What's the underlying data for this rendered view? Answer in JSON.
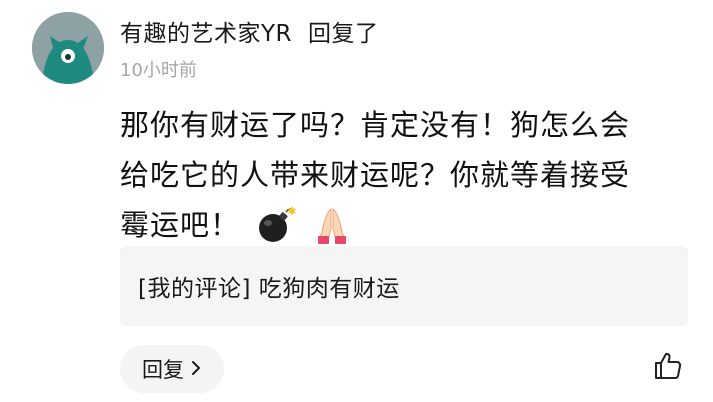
{
  "comment": {
    "username": "有趣的艺术家YR",
    "action": "回复了",
    "time": "10小时前",
    "lines": [
      "那你有财运了吗？肯定没有！狗怎么会",
      "给吃它的人带来财运呢？你就等着接受",
      "霉运吧！"
    ],
    "emojis": [
      "bomb-emoji",
      "folded-hands-emoji"
    ]
  },
  "quoted": {
    "text": "[我的评论] 吃狗肉有财运"
  },
  "footer": {
    "reply_label": "回复",
    "reply_icon": "chevron-right-icon",
    "like_icon": "thumbs-up-icon"
  },
  "colors": {
    "avatar_bg": "#8ea2a6",
    "avatar_figure": "#1f8b80",
    "time": "#a6a6a6",
    "quote_bg": "#f5f5f5",
    "reply_bg": "#f4f4f4"
  }
}
